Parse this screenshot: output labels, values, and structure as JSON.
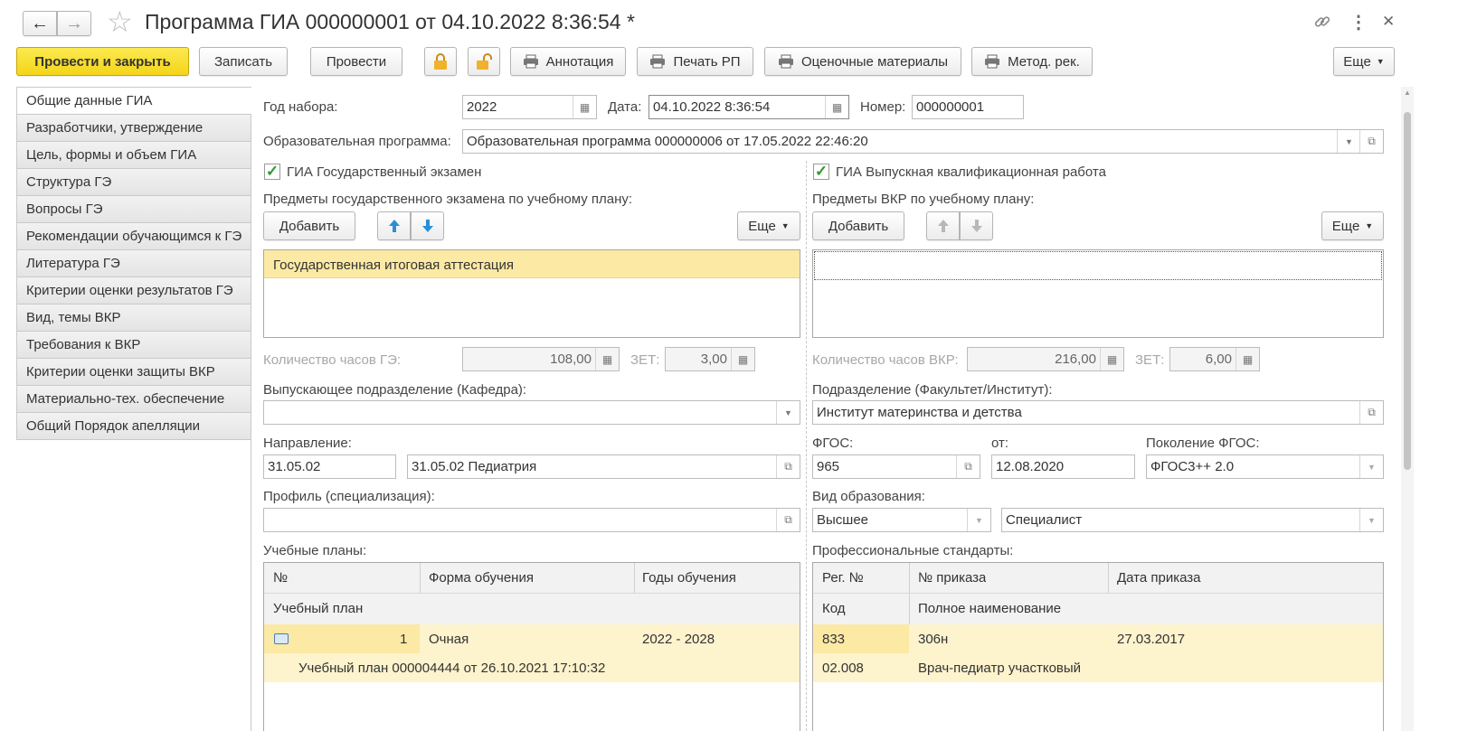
{
  "window": {
    "title": "Программа ГИА 000000001 от 04.10.2022 8:36:54 *",
    "nav_back": "←",
    "nav_forward": "→",
    "star": "☆",
    "link_icon": "link-icon",
    "more_icon": "⋮",
    "close_icon": "✕"
  },
  "toolbar": {
    "post_close": "Провести и закрыть",
    "save": "Записать",
    "post": "Провести",
    "annotation": "Аннотация",
    "print_rp": "Печать РП",
    "assessment": "Оценочные материалы",
    "method": "Метод. рек.",
    "more": "Еще"
  },
  "sidebar": {
    "items": [
      {
        "label": "Общие данные ГИА"
      },
      {
        "label": "Разработчики, утверждение"
      },
      {
        "label": "Цель, формы и объем ГИА"
      },
      {
        "label": "Структура ГЭ"
      },
      {
        "label": "Вопросы ГЭ"
      },
      {
        "label": "Рекомендации обучающимся к ГЭ"
      },
      {
        "label": "Литература ГЭ"
      },
      {
        "label": "Критерии оценки результатов ГЭ"
      },
      {
        "label": "Вид, темы ВКР"
      },
      {
        "label": "Требования к ВКР"
      },
      {
        "label": "Критерии оценки защиты ВКР"
      },
      {
        "label": "Материально-тех. обеспечение"
      },
      {
        "label": "Общий Порядок апелляции"
      }
    ]
  },
  "form": {
    "year_label": "Год набора:",
    "year_value": "2022",
    "date_label": "Дата:",
    "date_value": "04.10.2022  8:36:54",
    "number_label": "Номер:",
    "number_value": "000000001",
    "program_label": "Образовательная программа:",
    "program_value": "Образовательная программа 000000006 от 17.05.2022 22:46:20",
    "ge_check_label": "ГИА Государственный экзамен",
    "ge_subjects_label": "Предметы государственного экзамена по учебному плану:",
    "add_label": "Добавить",
    "more_label": "Еще",
    "ge_rows": [
      "Государственная итоговая аттестация"
    ],
    "vkr_check_label": "ГИА Выпускная квалификационная работа",
    "vkr_subjects_label": "Предметы ВКР по учебному плану:",
    "ge_hours_label": "Количество часов ГЭ:",
    "ge_hours_value": "108,00",
    "zet_label": "ЗЕТ:",
    "ge_zet_value": "3,00",
    "vkr_hours_label": "Количество часов ВКР:",
    "vkr_hours_value": "216,00",
    "vkr_zet_value": "6,00",
    "dept_label": "Выпускающее подразделение (Кафедра):",
    "dept_value": "",
    "faculty_label": "Подразделение (Факультет/Институт):",
    "faculty_value": "Институт материнства и детства",
    "direction_label": "Направление:",
    "direction_code": "31.05.02",
    "direction_name": "31.05.02 Педиатрия",
    "fgos_label": "ФГОС:",
    "fgos_value": "965",
    "from_label": "от:",
    "from_value": "12.08.2020",
    "fgos_gen_label": "Поколение ФГОС:",
    "fgos_gen_value": "ФГОС3++ 2.0",
    "profile_label": "Профиль (специализация):",
    "profile_value": "",
    "edu_type_label": "Вид образования:",
    "edu_level_value": "Высшее",
    "edu_kind_value": "Специалист",
    "plans_label": "Учебные планы:",
    "standards_label": "Профессиональные стандарты:"
  },
  "plans_table": {
    "headers": [
      "№",
      "Форма обучения",
      "Годы обучения"
    ],
    "subheader": "Учебный план",
    "row": {
      "num": "1",
      "form": "Очная",
      "years": "2022 - 2028",
      "plan": "Учебный план 000004444 от 26.10.2021 17:10:32"
    }
  },
  "standards_table": {
    "headers": [
      "Рег. №",
      "№ приказа",
      "Дата приказа"
    ],
    "subheaders": [
      "Код",
      "Полное наименование"
    ],
    "row": {
      "reg": "833",
      "order": "306н",
      "date": "27.03.2017",
      "code": "02.008",
      "name": "Врач-педиатр участковый"
    }
  },
  "colors": {
    "primary_button": "#f4d51a",
    "selected_row": "#fce9a4",
    "row_bg": "#fdf3cd",
    "checkbox_green": "#2f9a2f",
    "arrow_blue": "#2a8fd6"
  }
}
